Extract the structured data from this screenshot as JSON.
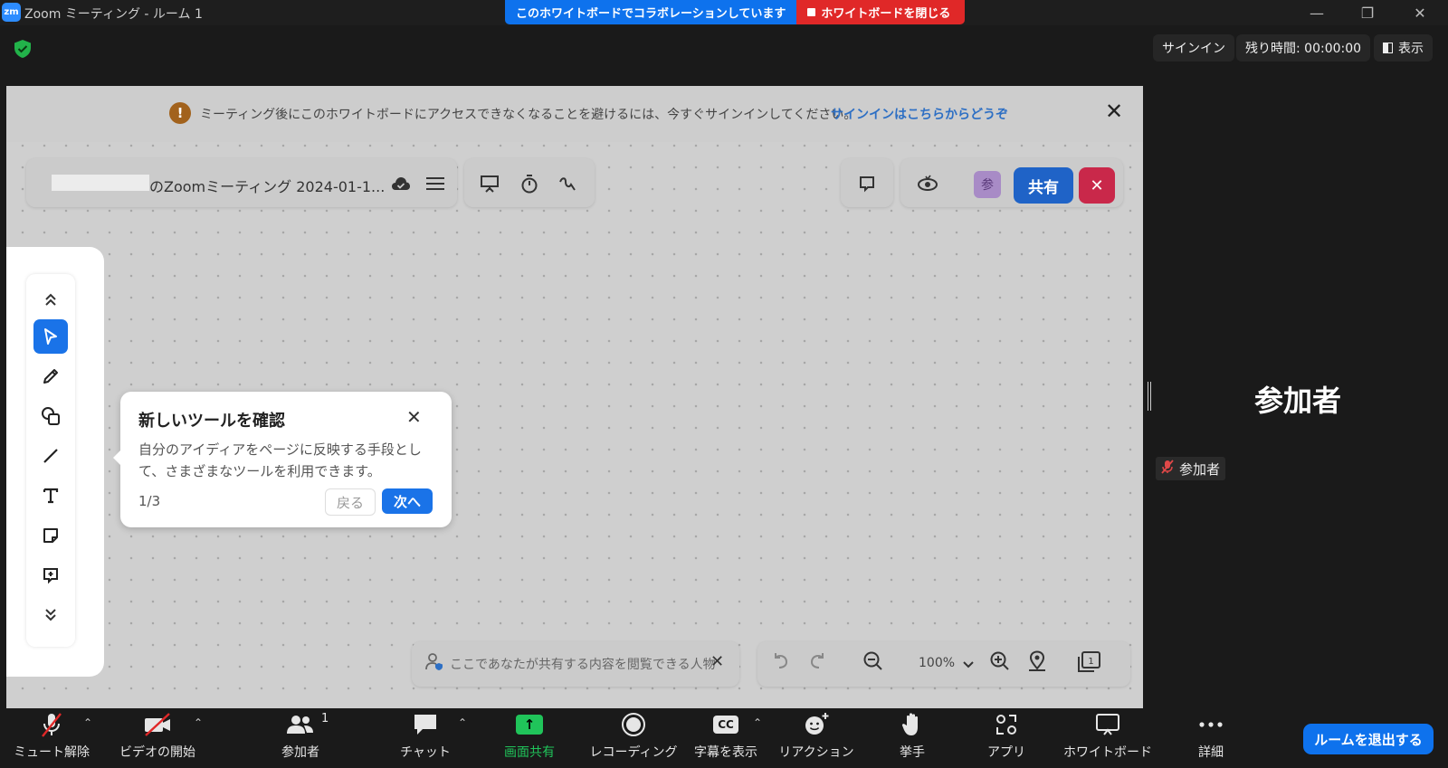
{
  "window": {
    "logo": "zm",
    "title": "Zoom ミーティング - ルーム 1",
    "minimize": "—",
    "restore": "❐",
    "close": "✕"
  },
  "banner": {
    "collab_text": "このホワイトボードでコラボレーションしています",
    "close_label": "ホワイトボードを閉じる"
  },
  "header": {
    "signin": "サインイン",
    "remaining_time": "残り時間: 00:00:00",
    "view": "表示"
  },
  "whiteboard": {
    "notice_icon": "!",
    "notice_text": "ミーティング後にこのホワイトボードにアクセスできなくなることを避けるには、今すぐサインインしてください。",
    "notice_link": "サインインはこちらからどうぞ",
    "notice_close": "✕",
    "title": "のZoomミーティング 2024-01-1...",
    "participant_avatar": "参",
    "share_label": "共有",
    "exit_label": "✕",
    "zoom_level": "100%",
    "viewers_text": "ここであなたが共有する内容を閲覧できる人物"
  },
  "tooltip": {
    "title": "新しいツールを確認",
    "body": "自分のアイディアをページに反映する手段として、さまざまなツールを利用できます。",
    "step": "1/3",
    "back": "戻る",
    "next": "次へ",
    "close": "✕"
  },
  "participants": {
    "title": "参加者",
    "name": "参加者"
  },
  "toolbar": {
    "mute": "ミュート解除",
    "video": "ビデオの開始",
    "participants": "参加者",
    "participants_count": "1",
    "chat": "チャット",
    "share": "画面共有",
    "record": "レコーディング",
    "captions": "字幕を表示",
    "captions_icon": "CC",
    "reactions": "リアクション",
    "raise_hand": "挙手",
    "apps": "アプリ",
    "whiteboard": "ホワイトボード",
    "more": "詳細",
    "leave": "ルームを退出する"
  },
  "colors": {
    "accent": "#0e72ed",
    "danger": "#e02828",
    "share_green": "#20c45a"
  }
}
